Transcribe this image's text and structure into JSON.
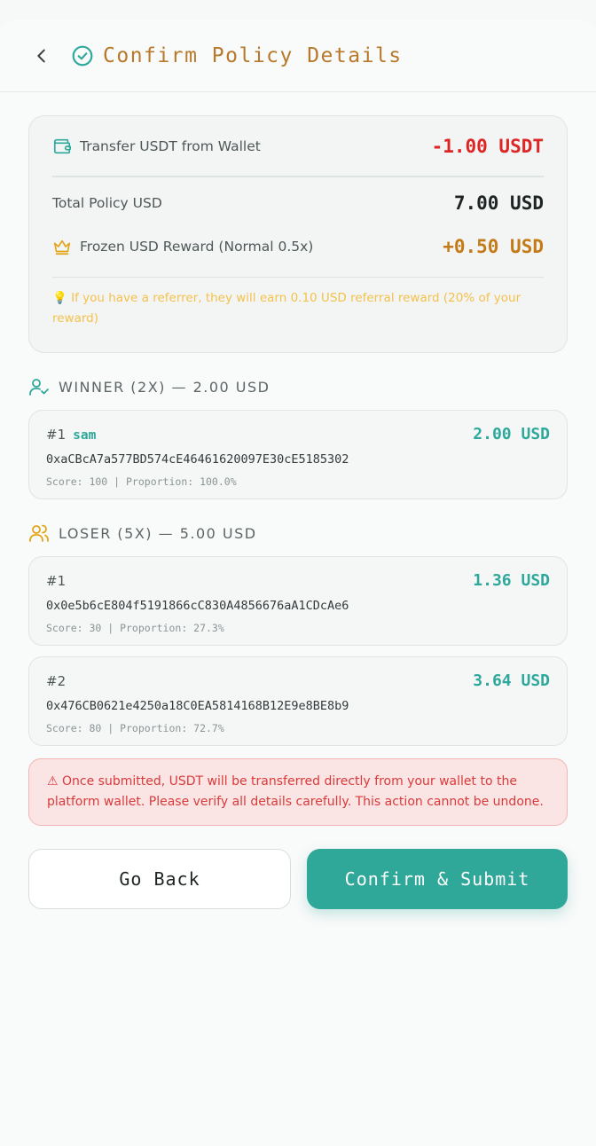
{
  "header": {
    "title": "Confirm Policy Details"
  },
  "summary": {
    "transfer_label": "Transfer USDT from Wallet",
    "transfer_amount": "-1.00 USDT",
    "total_label": "Total Policy USD",
    "total_amount": "7.00 USD",
    "reward_label": "Frozen USD Reward (Normal 0.5x)",
    "reward_amount": "+0.50 USD",
    "hint": "💡 If you have a referrer, they will earn 0.10 USD referral reward (20% of your reward)"
  },
  "winner": {
    "heading": "WINNER (2X) — 2.00 USD",
    "entries": [
      {
        "index": "#1",
        "name": "sam",
        "amount": "2.00 USD",
        "address": "0xaCBcA7a577BD574cE46461620097E30cE5185302",
        "score": "Score: 100 | Proportion: 100.0%"
      }
    ]
  },
  "loser": {
    "heading": "LOSER (5X) — 5.00 USD",
    "entries": [
      {
        "index": "#1",
        "amount": "1.36 USD",
        "address": "0x0e5b6cE804f5191866cC830A4856676aA1CDcAe6",
        "score": "Score: 30 | Proportion: 27.3%"
      },
      {
        "index": "#2",
        "amount": "3.64 USD",
        "address": "0x476CB0621e4250a18C0EA5814168B12E9e8BE8b9",
        "score": "Score: 80 | Proportion: 72.7%"
      }
    ]
  },
  "warning": "⚠ Once submitted, USDT will be transferred directly from your wallet to the platform wallet. Please verify all details carefully. This action cannot be undone.",
  "buttons": {
    "back_label": "Go Back",
    "confirm_label": "Confirm & Submit"
  },
  "colors": {
    "accent": "#2fa799",
    "title_gold": "#b7792a",
    "negative": "#dc2626",
    "reward_gold": "#c47b17",
    "warning_bg": "#fbe4e4"
  },
  "icons": [
    "chevron-left-icon",
    "check-circle-icon",
    "wallet-icon",
    "crown-icon",
    "user-check-icon",
    "users-icon"
  ]
}
